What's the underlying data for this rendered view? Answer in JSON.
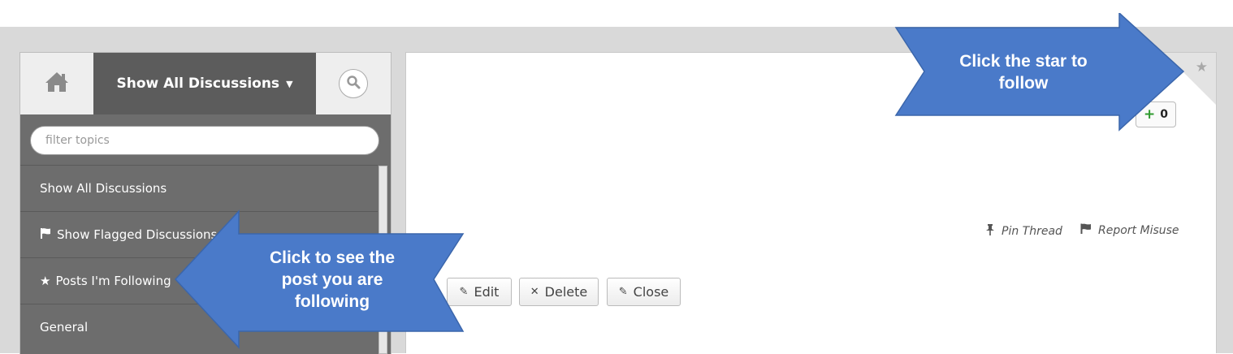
{
  "sidebar": {
    "home_icon": "home-icon",
    "show_all_label": "Show All Discussions",
    "show_all_caret": "▼",
    "search_icon": "search-icon",
    "filter": {
      "placeholder": "filter topics",
      "value": ""
    },
    "items": [
      {
        "label": "Show All Discussions",
        "icon": ""
      },
      {
        "label": "Show Flagged Discussions",
        "icon": "flag-icon"
      },
      {
        "label": "Posts I'm Following",
        "icon": "star-icon"
      },
      {
        "label": "General",
        "icon": ""
      }
    ]
  },
  "main": {
    "follow_icon": "star-icon",
    "vote": {
      "icon": "plus-icon",
      "count": "0"
    },
    "pin_label": "Pin Thread",
    "report_label": "Report Misuse",
    "actions": {
      "edit": "Edit",
      "delete": "Delete",
      "close": "Close"
    }
  },
  "callouts": {
    "star_text_line1": "Click the star to",
    "star_text_line2": "follow",
    "following_line1": "Click to see the",
    "following_line2": "post you are",
    "following_line3": "following",
    "color": "#4a7ac9"
  },
  "colors": {
    "sidebar_bg": "#6d6d6d",
    "band": "#d9d9d9",
    "callout": "#4a7ac9"
  }
}
